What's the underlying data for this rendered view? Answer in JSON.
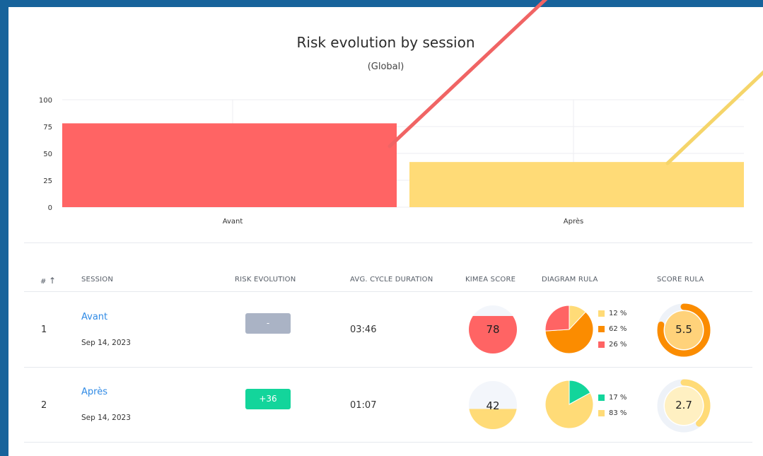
{
  "chart_data": {
    "type": "bar",
    "title": "Risk evolution by session",
    "subtitle": "(Global)",
    "categories": [
      "Avant",
      "Après"
    ],
    "values": [
      78,
      42
    ],
    "colors": [
      "#ff6464",
      "#ffdb77"
    ],
    "ylim": [
      0,
      100
    ],
    "yticks": [
      "100",
      "75",
      "50",
      "25",
      "0"
    ],
    "grid": true
  },
  "table": {
    "headers": {
      "index": "#",
      "sort_icon": "arrow-up-icon",
      "session": "SESSION",
      "risk": "RISK EVOLUTION",
      "duration": "AVG. CYCLE DURATION",
      "kimea": "KIMEA SCORE",
      "diagram": "DIAGRAM RULA",
      "rula": "SCORE RULA"
    },
    "rows": [
      {
        "index": "1",
        "session": "Avant",
        "date": "Sep 14, 2023",
        "risk_badge": "-",
        "risk_color": "#aab3c5",
        "duration": "03:46",
        "kimea_score": "78",
        "kimea_fraction": 0.78,
        "kimea_color": "#ff6464",
        "diagram": [
          {
            "label": "12 %",
            "value": 12,
            "color": "#ffdb77"
          },
          {
            "label": "62 %",
            "value": 62,
            "color": "#fb8c00"
          },
          {
            "label": "26 %",
            "value": 26,
            "color": "#ff6464"
          }
        ],
        "rula_score": "5.5",
        "rula_fraction": 0.786,
        "rula_color": "#fb8c00",
        "rula_fill": "#ffd27a"
      },
      {
        "index": "2",
        "session": "Après",
        "date": "Sep 14, 2023",
        "risk_badge": "+36",
        "risk_color": "#13d59b",
        "duration": "01:07",
        "kimea_score": "42",
        "kimea_fraction": 0.42,
        "kimea_color": "#ffdb77",
        "diagram": [
          {
            "label": "17 %",
            "value": 17,
            "color": "#13d59b"
          },
          {
            "label": "83 %",
            "value": 83,
            "color": "#ffdb77"
          }
        ],
        "rula_score": "2.7",
        "rula_fraction": 0.386,
        "rula_color": "#ffdb77",
        "rula_fill": "#fff0c2"
      }
    ]
  },
  "annotation_colors": [
    "#f06464",
    "#f5d56a"
  ]
}
